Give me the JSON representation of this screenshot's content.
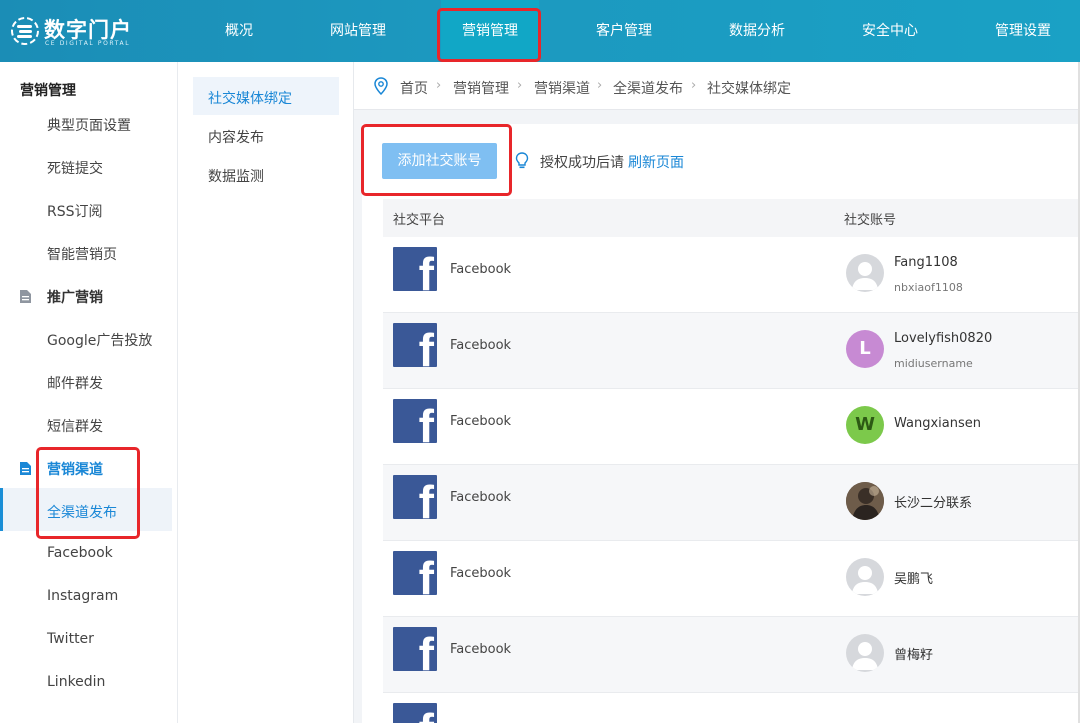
{
  "brand": {
    "title": "数字门户",
    "subtitle": "CE DIGITAL PORTAL"
  },
  "nav": {
    "items": [
      {
        "label": "概况"
      },
      {
        "label": "网站管理"
      },
      {
        "label": "营销管理"
      },
      {
        "label": "客户管理"
      },
      {
        "label": "数据分析"
      },
      {
        "label": "安全中心"
      },
      {
        "label": "管理设置"
      }
    ],
    "active": "营销管理"
  },
  "sidebar": {
    "title": "营销管理",
    "items": [
      {
        "label": "典型页面设置"
      },
      {
        "label": "死链提交"
      },
      {
        "label": "RSS订阅"
      },
      {
        "label": "智能营销页"
      },
      {
        "label": "推广营销"
      },
      {
        "label": "Google广告投放"
      },
      {
        "label": "邮件群发"
      },
      {
        "label": "短信群发"
      },
      {
        "label": "营销渠道"
      },
      {
        "label": "全渠道发布"
      },
      {
        "label": "Facebook"
      },
      {
        "label": "Instagram"
      },
      {
        "label": "Twitter"
      },
      {
        "label": "Linkedin"
      }
    ]
  },
  "subnav": {
    "items": [
      {
        "label": "社交媒体绑定"
      },
      {
        "label": "内容发布"
      },
      {
        "label": "数据监测"
      }
    ]
  },
  "breadcrumb": [
    "首页",
    "营销管理",
    "营销渠道",
    "全渠道发布",
    "社交媒体绑定"
  ],
  "toolbar": {
    "add_label": "添加社交账号",
    "hint_text": "授权成功后请",
    "hint_link": "刷新页面"
  },
  "table": {
    "columns": [
      "社交平台",
      "社交账号"
    ],
    "rows": [
      {
        "platform": "Facebook",
        "name": "Fang1108",
        "sub": "nbxiaof1108",
        "avatar": "default"
      },
      {
        "platform": "Facebook",
        "name": "Lovelyfish0820",
        "sub": "midiusername",
        "avatar": "L"
      },
      {
        "platform": "Facebook",
        "name": "Wangxiansen",
        "sub": "",
        "avatar": "W"
      },
      {
        "platform": "Facebook",
        "name": "长沙二分联系",
        "sub": "",
        "avatar": "photo"
      },
      {
        "platform": "Facebook",
        "name": "吴鹏飞",
        "sub": "",
        "avatar": "default"
      },
      {
        "platform": "Facebook",
        "name": "曾梅籽",
        "sub": "",
        "avatar": "default"
      }
    ]
  },
  "colors": {
    "topbar": "#1b8db6",
    "accent": "#1a87d6",
    "button": "#7fbff2",
    "highlight_red": "#e8262a",
    "facebook": "#3a5897",
    "avatar_L": "#c78ad3",
    "avatar_W": "#7cc94b",
    "avatar_default": "#d6d8dc"
  }
}
